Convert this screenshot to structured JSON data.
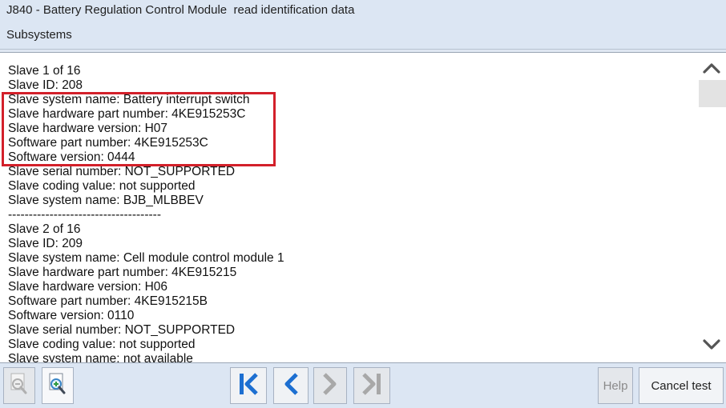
{
  "window": {
    "title": "J840 - Battery Regulation Control Module  read identification data",
    "subtitle": "Subsystems"
  },
  "content": {
    "lines": [
      "Slave 1 of 16",
      "Slave ID: 208",
      "Slave system name: Battery interrupt switch",
      "Slave hardware part number: 4KE915253C",
      "Slave hardware version: H07",
      "Software part number: 4KE915253C",
      "Software version: 0444",
      "Slave serial number: NOT_SUPPORTED",
      "Slave coding value: not supported",
      "Slave system name: BJB_MLBBEV",
      "-------------------------------------",
      "Slave 2 of 16",
      "Slave ID: 209",
      "Slave system name: Cell module control module 1",
      "Slave hardware part number: 4KE915215",
      "Slave hardware version: H06",
      "Software part number: 4KE915215B",
      "Software version: 0110",
      "Slave serial number: NOT_SUPPORTED",
      "Slave coding value: not supported",
      "Slave system name: not available"
    ],
    "highlight_color": "#d3202a"
  },
  "scrollbar": {
    "up_icon": "chevron-up-icon",
    "down_icon": "chevron-down-icon"
  },
  "footer": {
    "help_label": "Help",
    "cancel_label": "Cancel test",
    "accent_color": "#1d6fd1",
    "disabled_color": "#a8a8a8"
  }
}
